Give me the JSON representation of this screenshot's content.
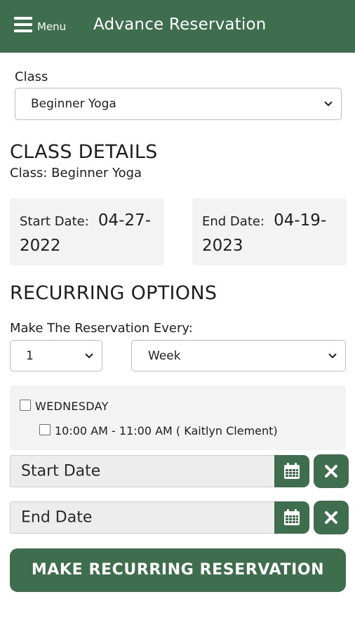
{
  "header": {
    "menu_label": "Menu",
    "title": "Advance Reservation",
    "menu_icon": "hamburger-icon",
    "background_color": "#3e6e4d"
  },
  "class_field": {
    "label": "Class",
    "selected": "Beginner Yoga"
  },
  "class_details": {
    "heading": "CLASS DETAILS",
    "class_line": "Class: Beginner Yoga",
    "start_date_label": "Start Date:",
    "start_date_value": "04-27-2022",
    "end_date_label": "End Date:",
    "end_date_value": "04-19-2023"
  },
  "recurring": {
    "heading": "RECURRING OPTIONS",
    "every_label": "Make The Reservation Every:",
    "count_selected": "1",
    "unit_selected": "Week",
    "day": {
      "label": "WEDNESDAY",
      "checked": false,
      "slot": {
        "label": "10:00 AM - 11:00 AM ( Kaitlyn Clement)",
        "checked": false
      }
    },
    "start_date_placeholder": "Start Date",
    "end_date_placeholder": "End Date",
    "calendar_icon": "calendar-icon",
    "clear_icon": "close-icon",
    "submit_label": "MAKE RECURRING RESERVATION"
  }
}
